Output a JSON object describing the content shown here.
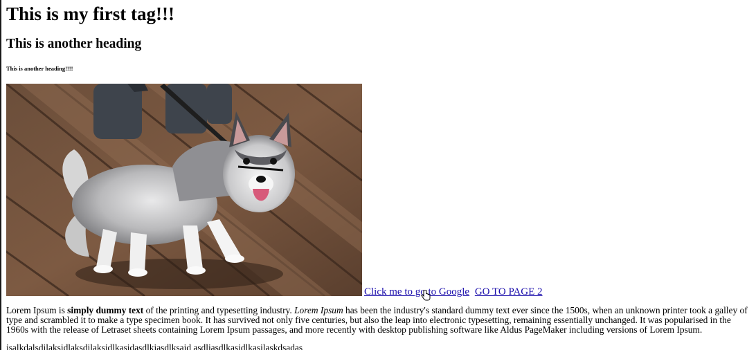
{
  "headings": {
    "h1": "This is my first tag!!!",
    "h2": "This is another heading",
    "h6": "This is another heading!!!!"
  },
  "image": {
    "icon": "husky-puppy-photo"
  },
  "links": {
    "google": "Click me to go to Google",
    "page2": "GO TO PAGE 2"
  },
  "paragraph": {
    "part1": "Lorem Ipsum is ",
    "bold": "simply dummy text",
    "part2": " of the printing and typesetting industry. ",
    "italic": "Lorem Ipsum",
    "part3": " has been the industry's standard dummy text ever since the 1500s, when an unknown printer took a galley of type and scrambled it to make a type specimen book. It has survived not only five centuries, but also the leap into electronic typesetting, remaining essentially unchanged. It was popularised in the 1960s with the release of Letraset sheets containing Lorem Ipsum passages, and more recently with desktop publishing software like Aldus PageMaker including versions of Lorem Ipsum."
  },
  "footer_text": "isalkdalsdilaksidlaksdilaksidlkasidasdlkiasdlksaid asdliasdlkasidlkasilaskdsadas"
}
